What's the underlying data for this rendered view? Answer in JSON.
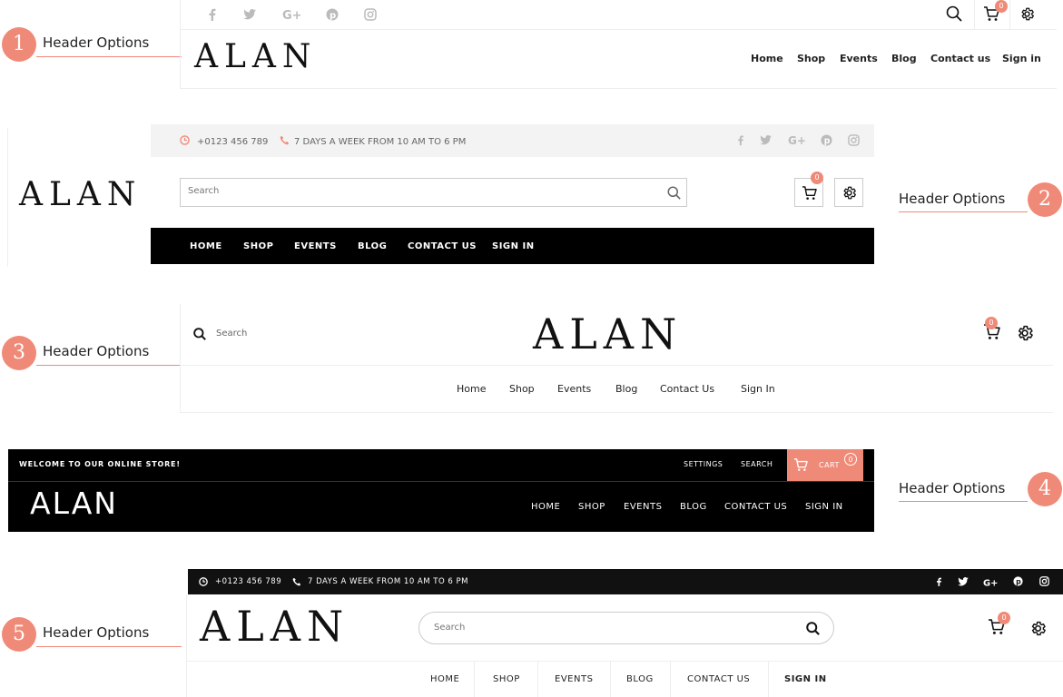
{
  "callout_label": "Header Options",
  "callouts": [
    {
      "num": "1",
      "label": "Header Options"
    },
    {
      "num": "2",
      "label": "Header Options"
    },
    {
      "num": "3",
      "label": "Header Options"
    },
    {
      "num": "4",
      "label": "Header Options"
    },
    {
      "num": "5",
      "label": "Header Options"
    }
  ],
  "colors": {
    "accent": "#f08a78",
    "dark": "#000000",
    "topbar_light": "#f3f3f3"
  },
  "header1": {
    "logo": "ALAN",
    "social_icons": [
      "facebook-icon",
      "twitter-icon",
      "google-plus-icon",
      "pinterest-icon",
      "instagram-icon"
    ],
    "cart_count": "0",
    "nav": [
      "Home",
      "Shop",
      "Events",
      "Blog",
      "Contact us",
      "Sign in"
    ]
  },
  "header2": {
    "logo": "ALAN",
    "phone": "+0123 456 789",
    "hours": "7 DAYS A WEEK FROM 10 AM TO 6 PM",
    "search_placeholder": "Search",
    "cart_count": "0",
    "nav": [
      "HOME",
      "SHOP",
      "EVENTS",
      "BLOG",
      "CONTACT US",
      "SIGN IN"
    ]
  },
  "header3": {
    "logo": "ALAN",
    "search_label": "Search",
    "cart_count": "0",
    "nav": [
      "Home",
      "Shop",
      "Events",
      "Blog",
      "Contact Us",
      "Sign In"
    ]
  },
  "header4": {
    "welcome": "WELCOME TO OUR ONLINE STORE!",
    "settings": "SETTINGS",
    "search": "SEARCH",
    "cart": "CART",
    "cart_count": "0",
    "logo": "ALAN",
    "nav": [
      "HOME",
      "SHOP",
      "EVENTS",
      "BLOG",
      "CONTACT US",
      "SIGN IN"
    ]
  },
  "header5": {
    "phone": "+0123 456 789",
    "hours": "7 DAYS A WEEK FROM 10 AM TO 6 PM",
    "logo": "ALAN",
    "search_placeholder": "Search",
    "cart_count": "0",
    "nav": [
      "HOME",
      "SHOP",
      "EVENTS",
      "BLOG",
      "CONTACT US",
      "SIGN IN"
    ]
  }
}
